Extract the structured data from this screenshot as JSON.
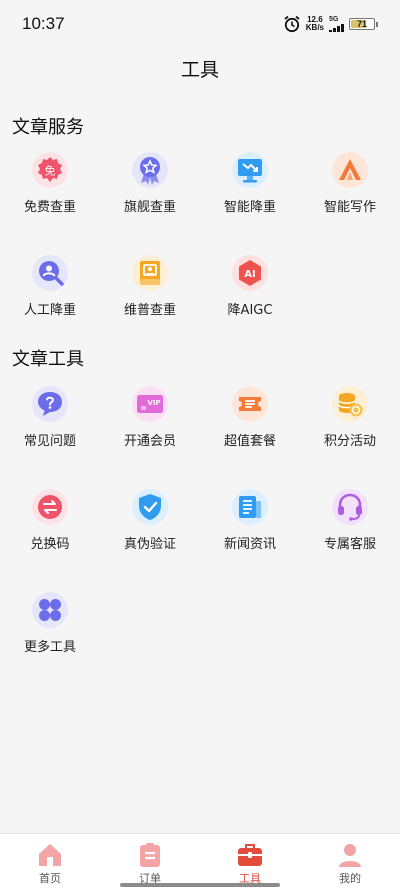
{
  "status_bar": {
    "time": "10:37",
    "net_speed_value": "12.6",
    "net_speed_unit": "KB/s",
    "signal_label": "5G",
    "battery_level": "71"
  },
  "page": {
    "title": "工具"
  },
  "sections": [
    {
      "title": "文章服务",
      "items": [
        {
          "label": "免费查重",
          "icon": "free-badge-icon",
          "color": "#f0546a"
        },
        {
          "label": "旗舰查重",
          "icon": "medal-icon",
          "color": "#6b6ee8"
        },
        {
          "label": "智能降重",
          "icon": "monitor-down-icon",
          "color": "#2f9cf0"
        },
        {
          "label": "智能写作",
          "icon": "ai-write-icon",
          "color": "#f47a3a"
        },
        {
          "label": "人工降重",
          "icon": "person-search-icon",
          "color": "#6b6ee8"
        },
        {
          "label": "维普查重",
          "icon": "book-stamp-icon",
          "color": "#f5a623"
        },
        {
          "label": "降AIGC",
          "icon": "ai-hexagon-icon",
          "color": "#ef5350"
        }
      ]
    },
    {
      "title": "文章工具",
      "items": [
        {
          "label": "常见问题",
          "icon": "question-bubble-icon",
          "color": "#6b6ee8"
        },
        {
          "label": "开通会员",
          "icon": "vip-card-icon",
          "color": "#e06ad8"
        },
        {
          "label": "超值套餐",
          "icon": "ticket-icon",
          "color": "#f47a3a"
        },
        {
          "label": "积分活动",
          "icon": "coins-icon",
          "color": "#f5a623"
        },
        {
          "label": "兑换码",
          "icon": "exchange-icon",
          "color": "#f0546a"
        },
        {
          "label": "真伪验证",
          "icon": "shield-check-icon",
          "color": "#2f9cf0"
        },
        {
          "label": "新闻资讯",
          "icon": "news-icon",
          "color": "#2f9cf0"
        },
        {
          "label": "专属客服",
          "icon": "headset-icon",
          "color": "#b05ce0"
        },
        {
          "label": "更多工具",
          "icon": "grid-dots-icon",
          "color": "#6b6ee8"
        }
      ]
    }
  ],
  "tabbar": {
    "items": [
      {
        "label": "首页",
        "icon": "home-icon",
        "active": false
      },
      {
        "label": "订单",
        "icon": "order-icon",
        "active": false
      },
      {
        "label": "工具",
        "icon": "toolbox-icon",
        "active": true
      },
      {
        "label": "我的",
        "icon": "profile-icon",
        "active": false
      }
    ],
    "inactive_color": "#f3a4a4",
    "active_color": "#e34b3d"
  }
}
